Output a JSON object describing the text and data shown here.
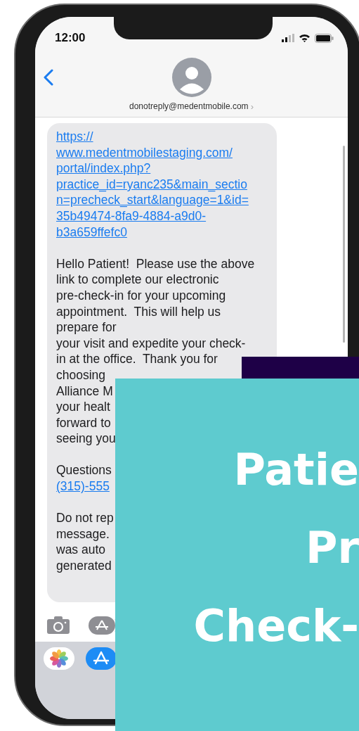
{
  "status_bar": {
    "time": "12:00"
  },
  "header": {
    "contact": "donotreply@medentmobile.com",
    "chevron": "›"
  },
  "message": {
    "link_lines": [
      "https://",
      "www.medentmobilestaging.com/",
      "portal/index.php?",
      "practice_id=ryanc235&main_sectio",
      "n=precheck_start&language=1&id=",
      "35b49474-8fa9-4884-a9d0-",
      "b3a659ffefc0"
    ],
    "paragraphs": [
      {
        "lines": [
          "Hello Patient!  Please use the above",
          "link to complete our electronic",
          "pre-check-in for your upcoming",
          "appointment.  This will help us",
          "prepare for",
          "your visit and expedite your check-",
          "in at the office.  Thank you for",
          "choosing",
          "Alliance M",
          "your healt",
          "forward to",
          "seeing you"
        ]
      },
      {
        "lines": [
          "Questions"
        ],
        "phone": "(315)-555"
      },
      {
        "lines": [
          "Do not rep",
          "message.",
          "was auto",
          "generated"
        ]
      }
    ]
  },
  "banner": {
    "title_lines": [
      "Patie",
      "Pr",
      "Check-"
    ]
  }
}
